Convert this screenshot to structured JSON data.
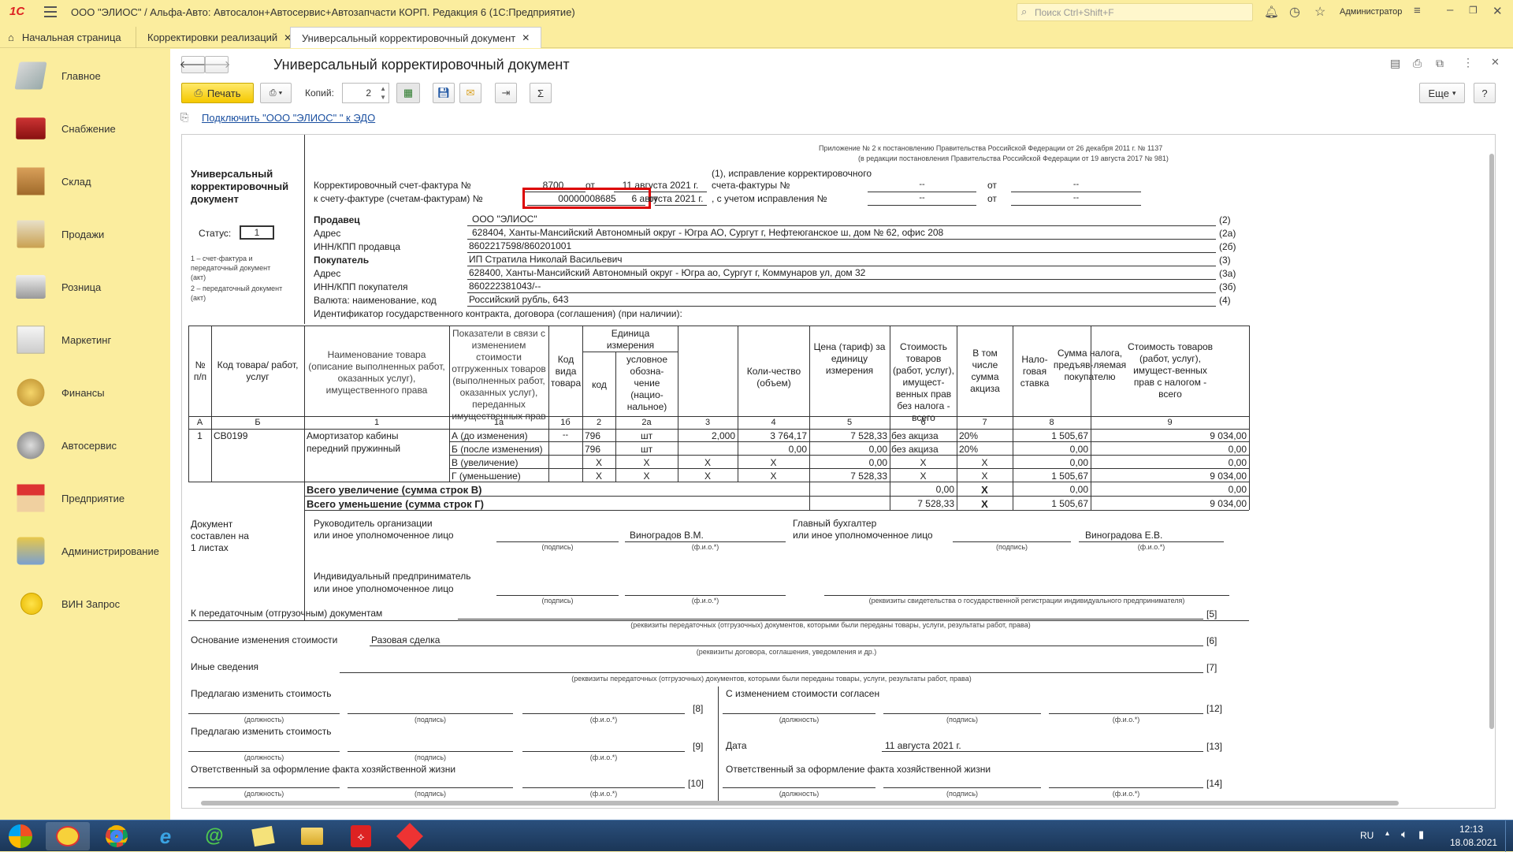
{
  "app": {
    "logo": "1С",
    "title": "ООО \"ЭЛИОС\" / Альфа-Авто: Автосалон+Автосервис+Автозапчасти КОРП. Редакция 6 (1С:Предприятие)",
    "search_placeholder": "Поиск Ctrl+Shift+F",
    "user": "Администратор"
  },
  "tabs": [
    {
      "label": "Начальная страница"
    },
    {
      "label": "Корректировки реализаций"
    },
    {
      "label": "Универсальный корректировочный документ"
    }
  ],
  "sidebar": {
    "items": [
      {
        "label": "Главное"
      },
      {
        "label": "Снабжение"
      },
      {
        "label": "Склад"
      },
      {
        "label": "Продажи"
      },
      {
        "label": "Розница"
      },
      {
        "label": "Маркетинг"
      },
      {
        "label": "Финансы"
      },
      {
        "label": "Автосервис"
      },
      {
        "label": "Предприятие"
      },
      {
        "label": "Администрирование"
      },
      {
        "label": "ВИН Запрос"
      }
    ]
  },
  "page": {
    "title": "Универсальный корректировочный документ"
  },
  "toolbar": {
    "print_label": "Печать",
    "copies_label": "Копий:",
    "copies_value": "2",
    "more_label": "Еще",
    "help_label": "?",
    "sigma": "Σ",
    "edo_link": "Подключить \"ООО \"ЭЛИОС\" \" к ЭДО"
  },
  "doc": {
    "appendix1": "Приложение № 2 к постановлению Правительства Российской Федерации от 26 декабря 2011 г. № 1137",
    "appendix2": "(в редакции постановления Правительства Российской Федерации от 19 августа 2017 № 981)",
    "title_l1": "Универсальный",
    "title_l2": "корректировочный",
    "title_l3": "документ",
    "status_label": "Статус:",
    "status_value": "1",
    "status_note1": "1 – счет-фактура и",
    "status_note2": "передаточный документ",
    "status_note3": "(акт)",
    "status_note4": "2 – передаточный документ",
    "status_note5": "(акт)",
    "corr_invoice_label": "Корректировочный счет-фактура №",
    "corr_invoice_no": "8700",
    "from1": "от",
    "corr_date": "11 августа 2021 г.",
    "fix_label1": "(1), исправление корректировочного",
    "fix_label2": "счета-фактуры №",
    "dash": "--",
    "to_invoice_label": "к счету-фактуре (счетам-фактурам) №",
    "to_invoice_no": "00000008685",
    "to_date": "6 августа 2021 г.",
    "fix_label3": ", с учетом исправления №",
    "seller_label": "Продавец",
    "seller": "ООО \"ЭЛИОС\"",
    "seller_code": "(2)",
    "address_label": "Адрес",
    "seller_address": "628404, Ханты-Мансийский Автономный округ - Югра АО, Сургут г, Нефтеюганское ш, дом № 62, офис 208",
    "seller_address_code": "(2а)",
    "seller_inn_label": "ИНН/КПП продавца",
    "seller_inn": "8602217598/860201001",
    "seller_inn_code": "(2б)",
    "buyer_label": "Покупатель",
    "buyer": "ИП Стратила Николай Васильевич",
    "buyer_code": "(3)",
    "buyer_address": "628400, Ханты-Мансийский Автономный округ - Югра ао, Сургут г, Коммунаров ул, дом 32",
    "buyer_address_code": "(3а)",
    "buyer_inn_label": "ИНН/КПП покупателя",
    "buyer_inn": "860222381043/--",
    "buyer_inn_code": "(3б)",
    "currency_label": "Валюта: наименование, код",
    "currency": "Российский рубль, 643",
    "currency_code": "(4)",
    "contract_label": "Идентификатор государственного контракта, договора (соглашения) (при наличии):",
    "th": {
      "c_no": "№ п/п",
      "c_code": "Код товара/ работ, услуг",
      "c_name": "Наименование товара (описание выполненных работ, оказанных услуг), имущественного права",
      "c_ind": "Показатели в связи с изменением стоимости отгруженных товаров (выполненных работ, оказанных услуг), переданных имущественных прав",
      "c_kind": "Код вида товара",
      "c_unit": "Единица измерения",
      "c_ucode": "код",
      "c_uname": "условное обозна-чение (нацио-нальное)",
      "c_qty": "Коли-чество (объем)",
      "c_price": "Цена (тариф) за единицу измерения",
      "c_cost": "Стоимость товаров (работ, услуг), имущест-венных прав без налога - всего",
      "c_excise": "В том числе сумма акциза",
      "c_rate": "Нало-говая ставка",
      "c_tax": "Сумма налога, предъяв-ляемая покупателю",
      "c_total": "Стоимость товаров (работ, услуг), имущест-венных прав с налогом - всего"
    },
    "tnum": [
      "А",
      "Б",
      "1",
      "1а",
      "1б",
      "2",
      "2а",
      "3",
      "4",
      "5",
      "6",
      "7",
      "8",
      "9"
    ],
    "item": {
      "no": "1",
      "code": "СВ0199",
      "name_l1": "Амортизатор кабины",
      "name_l2": "передний пружинный",
      "kind": "--"
    },
    "rows": [
      {
        "ind": "А (до изменения)",
        "ucode": "796",
        "uname": "шт",
        "qty": "2,000",
        "price": "3 764,17",
        "cost": "7 528,33",
        "excise": "без акциза",
        "rate": "20%",
        "tax": "1 505,67",
        "total": "9 034,00"
      },
      {
        "ind": "Б (после изменения)",
        "ucode": "796",
        "uname": "шт",
        "qty": "",
        "price": "0,00",
        "cost": "0,00",
        "excise": "без акциза",
        "rate": "20%",
        "tax": "0,00",
        "total": "0,00"
      },
      {
        "ind": "В (увеличение)",
        "ucode": "X",
        "uname": "X",
        "qty": "X",
        "price": "X",
        "cost": "0,00",
        "excise": "X",
        "rate": "X",
        "tax": "0,00",
        "total": "0,00"
      },
      {
        "ind": "Г (уменьшение)",
        "ucode": "X",
        "uname": "X",
        "qty": "X",
        "price": "X",
        "cost": "7 528,33",
        "excise": "X",
        "rate": "X",
        "tax": "1 505,67",
        "total": "9 034,00"
      }
    ],
    "sum_inc": {
      "label": "Всего увеличение (сумма строк В)",
      "cost": "0,00",
      "x": "X",
      "tax": "0,00",
      "total": "0,00"
    },
    "sum_dec": {
      "label": "Всего уменьшение (сумма строк Г)",
      "cost": "7 528,33",
      "x": "X",
      "tax": "1 505,67",
      "total": "9 034,00"
    },
    "pages_l1": "Документ",
    "pages_l2": "составлен на",
    "pages_l3": "1 листах",
    "head_l1": "Руководитель организации",
    "head_l2": "или иное уполномоченное лицо",
    "head_name": "Виноградов В.М.",
    "acc_l1": "Главный бухгалтер",
    "acc_l2": "или иное уполномоченное лицо",
    "acc_name": "Виноградова Е.В.",
    "sign_caption": "(подпись)",
    "fio_caption": "(ф.и.о.*)",
    "ip_l1": "Индивидуальный предприниматель",
    "ip_l2": "или иное уполномоченное лицо",
    "ip_caption": "(реквизиты свидетельства о государственной регистрации индивидуального предпринимателя)",
    "ship_label": "К передаточным (отгрузочным) документам",
    "ship_code": "[5]",
    "ship_caption": "(реквизиты передаточных (отгрузочных) документов, которыми были переданы товары, услуги, результаты работ, права)",
    "basis_label": "Основание изменения стоимости",
    "basis_value": "Разовая сделка",
    "basis_code": "[6]",
    "basis_caption": "(реквизиты договора, соглашения, уведомления и др.)",
    "other_label": "Иные сведения",
    "other_code": "[7]",
    "other_caption": "(реквизиты передаточных (отгрузочных) документов, которыми были переданы товары, услуги, результаты работ, права)",
    "propose_label": "Предлагаю изменить стоимость",
    "agree_label": "С изменением стоимости согласен",
    "pos_caption": "(должность)",
    "c8": "[8]",
    "c9": "[9]",
    "c10": "[10]",
    "c12": "[12]",
    "c13": "[13]",
    "c14": "[14]",
    "date_label": "Дата",
    "date_value": "11 августа 2021 г.",
    "resp_label": "Ответственный за оформление факта хозяйственной жизни"
  },
  "taskbar": {
    "lang": "RU",
    "time": "12:13",
    "date": "18.08.2021"
  }
}
